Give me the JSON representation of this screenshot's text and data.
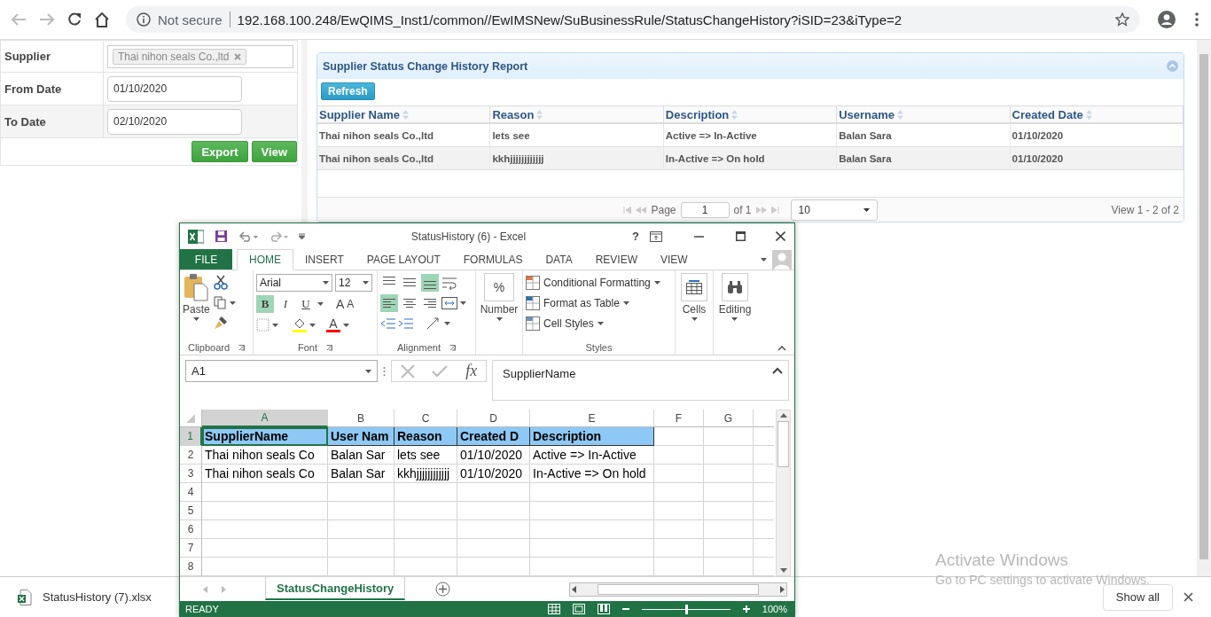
{
  "browser": {
    "security": "Not secure",
    "url": "192.168.100.248/EwQIMS_Inst1/common//EwIMSNew/SuBusinessRule/StatusChangeHistory?iSID=23&iType=2"
  },
  "filter": {
    "fields": [
      {
        "kind": "tags",
        "label": "Supplier",
        "tags": [
          "Thai nihon seals Co.,ltd"
        ]
      },
      {
        "kind": "date",
        "label": "From Date",
        "value": "01/10/2020"
      },
      {
        "kind": "date",
        "label": "To Date",
        "value": "02/10/2020"
      }
    ],
    "buttons": [
      "Export",
      "View"
    ]
  },
  "report": {
    "title": "Supplier Status Change History Report",
    "refresh": "Refresh",
    "columns": [
      "Supplier Name",
      "Reason",
      "Description",
      "Username",
      "Created Date"
    ],
    "rows": [
      [
        "Thai nihon seals Co.,ltd",
        "lets see",
        "Active => In-Active",
        "Balan Sara",
        "01/10/2020"
      ],
      [
        "Thai nihon seals Co.,ltd",
        "kkhjjjjjjjjjjjj",
        "In-Active => On hold",
        "Balan Sara",
        "01/10/2020"
      ]
    ],
    "pager": {
      "page_label": "Page",
      "page": "1",
      "of": "of 1",
      "page_size": "10",
      "summary": "View 1 - 2 of 2"
    }
  },
  "excel": {
    "title": "StatusHistory (6) - Excel",
    "help": "?",
    "tabs": [
      {
        "label": "FILE",
        "kind": "file",
        "selected": false
      },
      {
        "label": "HOME",
        "kind": "tab",
        "selected": true
      },
      {
        "label": "INSERT",
        "kind": "tab",
        "selected": false
      },
      {
        "label": "PAGE LAYOUT",
        "kind": "tab",
        "selected": false
      },
      {
        "label": "FORMULAS",
        "kind": "tab",
        "selected": false
      },
      {
        "label": "DATA",
        "kind": "tab",
        "selected": false
      },
      {
        "label": "REVIEW",
        "kind": "tab",
        "selected": false
      },
      {
        "label": "VIEW",
        "kind": "tab",
        "selected": false
      }
    ],
    "ribbon": {
      "clipboard": {
        "paste": "Paste",
        "group": "Clipboard"
      },
      "font": {
        "name": "Arial",
        "size": "12",
        "toggles": [
          {
            "label": "B",
            "on": true
          },
          {
            "label": "I",
            "on": false
          },
          {
            "label": "U",
            "on": false
          }
        ],
        "grow": "A",
        "shrink": "A",
        "color_letter": "A",
        "group": "Font"
      },
      "alignment": {
        "buttons": [
          {
            "kind": "top",
            "on": false
          },
          {
            "kind": "middle",
            "on": false
          },
          {
            "kind": "bottom",
            "on": true
          },
          {
            "kind": "left",
            "on": true
          },
          {
            "kind": "center",
            "on": false
          },
          {
            "kind": "right",
            "on": false
          }
        ],
        "group": "Alignment"
      },
      "number": {
        "symbol": "%",
        "label": "Number"
      },
      "styles": {
        "items": [
          "Conditional Formatting",
          "Format as Table",
          "Cell Styles"
        ],
        "group": "Styles"
      },
      "cells": "Cells",
      "editing": "Editing"
    },
    "name_box": "A1",
    "fx": "fx",
    "formula": "SupplierName",
    "columns": [
      {
        "label": "A",
        "selected": true
      },
      {
        "label": "B",
        "selected": false
      },
      {
        "label": "C",
        "selected": false
      },
      {
        "label": "D",
        "selected": false
      },
      {
        "label": "E",
        "selected": false
      },
      {
        "label": "F",
        "selected": false
      },
      {
        "label": "G",
        "selected": false
      }
    ],
    "rows": [
      {
        "number": "1",
        "selected": true,
        "kind": "header",
        "cells": [
          "SupplierName",
          "User Nam",
          "Reason",
          "Created D",
          "Description"
        ]
      },
      {
        "number": "2",
        "selected": false,
        "kind": "data",
        "cells": [
          "Thai nihon seals Co",
          "Balan Sar",
          "lets see",
          "01/10/2020",
          "Active => In-Active"
        ]
      },
      {
        "number": "3",
        "selected": false,
        "kind": "data",
        "cells": [
          "Thai nihon seals Co",
          "Balan Sar",
          "kkhjjjjjjjjjjjj",
          "01/10/2020",
          "In-Active => On hold"
        ]
      },
      {
        "number": "4",
        "selected": false,
        "kind": "data"
      },
      {
        "number": "5",
        "selected": false,
        "kind": "data"
      },
      {
        "number": "6",
        "selected": false,
        "kind": "data"
      },
      {
        "number": "7",
        "selected": false,
        "kind": "data"
      },
      {
        "number": "8",
        "selected": false,
        "kind": "data"
      }
    ],
    "sheet_tab": "StatusChangeHistory",
    "status": "READY",
    "zoom": {
      "label": "100%",
      "level": 0.5
    }
  },
  "downloads": {
    "file": "StatusHistory (7).xlsx",
    "show_all": "Show all"
  },
  "os_notice": {
    "title": "Activate Windows",
    "text": "Go to PC settings to activate Windows."
  }
}
